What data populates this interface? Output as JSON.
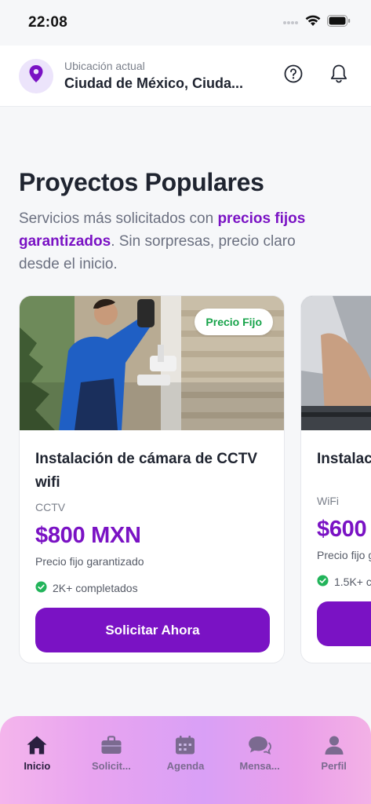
{
  "status_bar": {
    "time": "22:08"
  },
  "header": {
    "location_caption": "Ubicación actual",
    "location_value": "Ciudad de México, Ciuda..."
  },
  "section": {
    "title": "Proyectos Populares",
    "desc_pre": "Servicios más solicitados con ",
    "desc_highlight": "precios fijos garantizados",
    "desc_post": ". Sin sorpresas, precio claro desde el inicio."
  },
  "cards": [
    {
      "badge": "Precio Fijo",
      "title": "Instalación de cámara de CCTV wifi",
      "category": "CCTV",
      "price": "$800 MXN",
      "price_note": "Precio fijo garantizado",
      "completed": "2K+ completados",
      "cta": "Solicitar Ahora"
    },
    {
      "title": "Instalac",
      "category": "WiFi",
      "price": "$600",
      "price_note": "Precio fijo g",
      "completed": "1.5K+ c"
    }
  ],
  "nav": [
    {
      "label": "Inicio",
      "icon": "home-icon"
    },
    {
      "label": "Solicit...",
      "icon": "briefcase-icon"
    },
    {
      "label": "Agenda",
      "icon": "calendar-icon"
    },
    {
      "label": "Mensa...",
      "icon": "chat-icon"
    },
    {
      "label": "Perfil",
      "icon": "person-icon"
    }
  ],
  "colors": {
    "accent": "#7a12c4",
    "success": "#17a34a",
    "pin_bg": "#ece4fb"
  }
}
